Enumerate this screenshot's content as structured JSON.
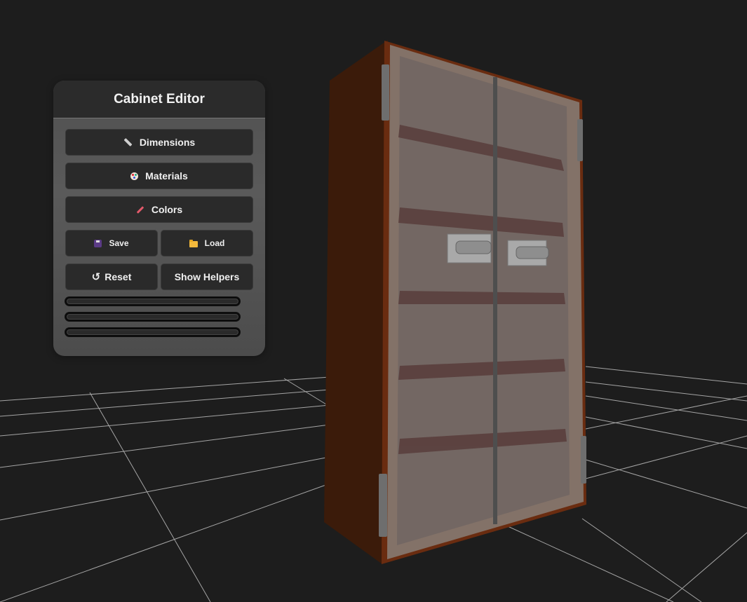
{
  "panel": {
    "title": "Cabinet Editor",
    "buttons": {
      "dimensions": "Dimensions",
      "materials": "Materials",
      "colors": "Colors",
      "save": "Save",
      "load": "Load",
      "reset": "Reset",
      "show_helpers": "Show Helpers"
    },
    "icons": {
      "dimensions": "ruler-icon",
      "materials": "palette-icon",
      "colors": "paintbrush-icon",
      "save": "floppy-disk-icon",
      "load": "folder-icon",
      "reset": "reset-icon"
    }
  },
  "scene": {
    "background": "#1d1d1d",
    "grid_color": "#bdbdbd",
    "cabinet_body_color": "#3b1b0a",
    "glass_tint": "#8a7a72",
    "handle_color": "#9a9a9a"
  }
}
